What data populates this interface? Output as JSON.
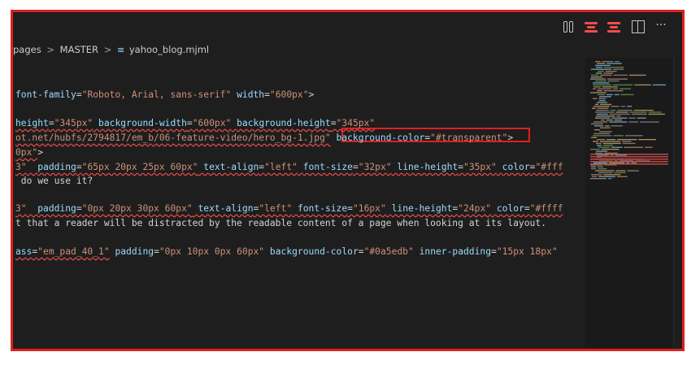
{
  "breadcrumb": {
    "items": [
      "pages",
      "MASTER",
      "yahoo_blog.mjml"
    ],
    "separator": ">",
    "file_icon": "≡"
  },
  "toolbar": {
    "icons": [
      "compare-changes-icon",
      "open-changes-icon",
      "toggle-changes-icon",
      "split-editor-icon",
      "more-actions-icon"
    ],
    "more_label": "···"
  },
  "editor": {
    "lines": [
      [
        {
          "c": "a",
          "t": "font-family"
        },
        {
          "c": "p",
          "t": "="
        },
        {
          "c": "v",
          "t": "\"Roboto, Arial, sans-serif\""
        },
        {
          "c": "p",
          "t": " "
        },
        {
          "c": "a",
          "t": "width"
        },
        {
          "c": "p",
          "t": "="
        },
        {
          "c": "v",
          "t": "\"600px\""
        },
        {
          "c": "p",
          "t": ">"
        }
      ],
      [
        {
          "c": "a sq",
          "t": "height"
        },
        {
          "c": "p sq",
          "t": "="
        },
        {
          "c": "v sq",
          "t": "\"345px\""
        },
        {
          "c": "p sq",
          "t": " "
        },
        {
          "c": "a sq",
          "t": "background-width"
        },
        {
          "c": "p sq",
          "t": "="
        },
        {
          "c": "v sq",
          "t": "\"600px\""
        },
        {
          "c": "p sq",
          "t": " "
        },
        {
          "c": "a sq",
          "t": "background-height"
        },
        {
          "c": "p sq",
          "t": "="
        },
        {
          "c": "v sq",
          "t": "\"345px\""
        }
      ],
      [
        {
          "c": "v sq",
          "t": "ot.net/hubfs/2794817/em_b/06-feature-video/hero_bg-1.jpg\""
        },
        {
          "c": "p",
          "t": " "
        },
        {
          "c": "a",
          "t": "background-color"
        },
        {
          "c": "p",
          "t": "="
        },
        {
          "c": "v",
          "t": "\"#transparent\""
        },
        {
          "c": "p",
          "t": ">"
        }
      ],
      [
        {
          "c": "v sq",
          "t": "0px\""
        },
        {
          "c": "p",
          "t": ">"
        }
      ],
      [
        {
          "c": "v sq",
          "t": "3\""
        },
        {
          "c": "p sq",
          "t": "  "
        },
        {
          "c": "a sq",
          "t": "padding"
        },
        {
          "c": "p sq",
          "t": "="
        },
        {
          "c": "v sq",
          "t": "\"65px 20px 25px 60px\""
        },
        {
          "c": "p sq",
          "t": " "
        },
        {
          "c": "a sq",
          "t": "text-align"
        },
        {
          "c": "p sq",
          "t": "="
        },
        {
          "c": "v sq",
          "t": "\"left\""
        },
        {
          "c": "p sq",
          "t": " "
        },
        {
          "c": "a sq",
          "t": "font-size"
        },
        {
          "c": "p sq",
          "t": "="
        },
        {
          "c": "v sq",
          "t": "\"32px\""
        },
        {
          "c": "p sq",
          "t": " "
        },
        {
          "c": "a sq",
          "t": "line-height"
        },
        {
          "c": "p sq",
          "t": "="
        },
        {
          "c": "v sq",
          "t": "\"35px\""
        },
        {
          "c": "p sq",
          "t": " "
        },
        {
          "c": "a sq",
          "t": "color"
        },
        {
          "c": "p sq",
          "t": "="
        },
        {
          "c": "v sq",
          "t": "\"#fff"
        }
      ],
      [
        {
          "c": "t",
          "t": " do we use it?"
        }
      ],
      [],
      [
        {
          "c": "v sq",
          "t": "3\""
        },
        {
          "c": "p sq",
          "t": "  "
        },
        {
          "c": "a sq",
          "t": "padding"
        },
        {
          "c": "p sq",
          "t": "="
        },
        {
          "c": "v sq",
          "t": "\"0px 20px 30px 60px\""
        },
        {
          "c": "p sq",
          "t": " "
        },
        {
          "c": "a sq",
          "t": "text-align"
        },
        {
          "c": "p sq",
          "t": "="
        },
        {
          "c": "v sq",
          "t": "\"left\""
        },
        {
          "c": "p sq",
          "t": " "
        },
        {
          "c": "a sq",
          "t": "font-size"
        },
        {
          "c": "p sq",
          "t": "="
        },
        {
          "c": "v sq",
          "t": "\"16px\""
        },
        {
          "c": "p sq",
          "t": " "
        },
        {
          "c": "a sq",
          "t": "line-height"
        },
        {
          "c": "p sq",
          "t": "="
        },
        {
          "c": "v sq",
          "t": "\"24px\""
        },
        {
          "c": "p sq",
          "t": " "
        },
        {
          "c": "a sq",
          "t": "color"
        },
        {
          "c": "p sq",
          "t": "="
        },
        {
          "c": "v sq",
          "t": "\"#ffff"
        }
      ],
      [
        {
          "c": "t",
          "t": "t that a reader will be distracted by the readable content of a page when looking at its layout."
        }
      ],
      [],
      [
        {
          "c": "a sq",
          "t": "ass"
        },
        {
          "c": "p sq",
          "t": "="
        },
        {
          "c": "v sq",
          "t": "\"em_pad_40_1\""
        },
        {
          "c": "p",
          "t": " "
        },
        {
          "c": "a",
          "t": "padding"
        },
        {
          "c": "p",
          "t": "="
        },
        {
          "c": "v",
          "t": "\"0px 10px 0px 60px\""
        },
        {
          "c": "p",
          "t": " "
        },
        {
          "c": "a",
          "t": "background-color"
        },
        {
          "c": "p",
          "t": "="
        },
        {
          "c": "v",
          "t": "\"#0a5edb\""
        },
        {
          "c": "p",
          "t": " "
        },
        {
          "c": "a",
          "t": "inner-padding"
        },
        {
          "c": "p",
          "t": "="
        },
        {
          "c": "v",
          "t": "\"15px 18px\""
        }
      ]
    ]
  },
  "colors": {
    "attribute": "#9cdcfe",
    "string": "#ce9178",
    "text": "#d4d4d4",
    "error_squiggle": "#f14c4c",
    "highlight_border": "#e02020",
    "background": "#1e1e1e"
  }
}
